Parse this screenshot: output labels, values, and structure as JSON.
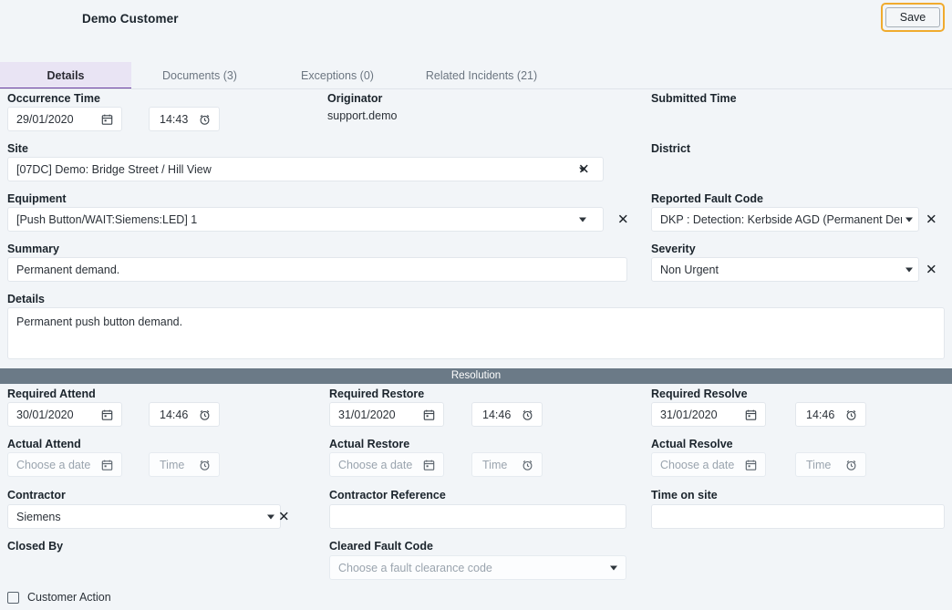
{
  "header": {
    "title": "Demo Customer",
    "save_label": "Save"
  },
  "tabs": [
    {
      "label": "Details",
      "active": true
    },
    {
      "label": "Documents (3)",
      "active": false
    },
    {
      "label": "Exceptions (0)",
      "active": false
    },
    {
      "label": "Related Incidents (21)",
      "active": false
    }
  ],
  "details": {
    "occurrence_time_label": "Occurrence Time",
    "occurrence_date_value": "29/01/2020",
    "occurrence_time_value": "14:43",
    "originator_label": "Originator",
    "originator_value": "support.demo",
    "submitted_time_label": "Submitted Time",
    "submitted_time_value": "",
    "site_label": "Site",
    "site_value": "[07DC] Demo: Bridge Street  / Hill View",
    "district_label": "District",
    "district_value": "",
    "equipment_label": "Equipment",
    "equipment_value": "[Push Button/WAIT:Siemens:LED] 1",
    "reported_fault_code_label": "Reported Fault Code",
    "reported_fault_code_value": "DKP : Detection: Kerbside AGD (Permanent Dem",
    "summary_label": "Summary",
    "summary_value": "Permanent demand.",
    "severity_label": "Severity",
    "severity_value": "Non Urgent",
    "details_label": "Details",
    "details_value": "Permanent push button demand."
  },
  "resolution": {
    "section_label": "Resolution",
    "required_attend_label": "Required Attend",
    "required_attend_date": "30/01/2020",
    "required_attend_time": "14:46",
    "required_restore_label": "Required Restore",
    "required_restore_date": "31/01/2020",
    "required_restore_time": "14:46",
    "required_resolve_label": "Required Resolve",
    "required_resolve_date": "31/01/2020",
    "required_resolve_time": "14:46",
    "actual_attend_label": "Actual Attend",
    "actual_restore_label": "Actual Restore",
    "actual_resolve_label": "Actual Resolve",
    "date_placeholder": "Choose a date",
    "time_placeholder": "Time",
    "contractor_label": "Contractor",
    "contractor_value": "Siemens",
    "contractor_reference_label": "Contractor Reference",
    "contractor_reference_value": "",
    "time_on_site_label": "Time on site",
    "time_on_site_value": "",
    "closed_by_label": "Closed By",
    "closed_by_value": "",
    "cleared_fault_code_label": "Cleared Fault Code",
    "cleared_fault_code_placeholder": "Choose a fault clearance code",
    "customer_action_label": "Customer Action"
  },
  "colors": {
    "accent_purple": "#6b3fa0",
    "focus_orange": "#f0ab2e",
    "section_bar": "#6b7a87",
    "page_bg": "#f2f5f8"
  }
}
